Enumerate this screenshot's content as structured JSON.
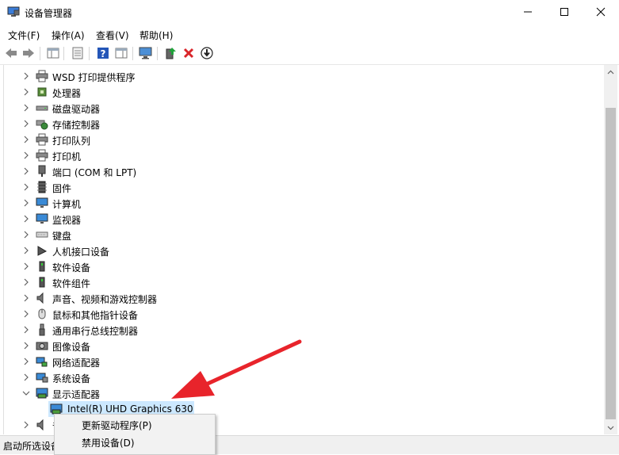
{
  "window": {
    "title": "设备管理器"
  },
  "menu": [
    {
      "label": "文件(F)"
    },
    {
      "label": "操作(A)"
    },
    {
      "label": "查看(V)"
    },
    {
      "label": "帮助(H)"
    }
  ],
  "tree": [
    {
      "label": "WSD 打印提供程序",
      "icon": "printer-provider-icon"
    },
    {
      "label": "处理器",
      "icon": "processor-icon"
    },
    {
      "label": "磁盘驱动器",
      "icon": "disk-drive-icon"
    },
    {
      "label": "存储控制器",
      "icon": "storage-controller-icon"
    },
    {
      "label": "打印队列",
      "icon": "print-queue-icon"
    },
    {
      "label": "打印机",
      "icon": "printer-icon"
    },
    {
      "label": "端口 (COM 和 LPT)",
      "icon": "port-icon"
    },
    {
      "label": "固件",
      "icon": "firmware-icon"
    },
    {
      "label": "计算机",
      "icon": "computer-icon"
    },
    {
      "label": "监视器",
      "icon": "monitor-icon"
    },
    {
      "label": "键盘",
      "icon": "keyboard-icon"
    },
    {
      "label": "人机接口设备",
      "icon": "hid-icon"
    },
    {
      "label": "软件设备",
      "icon": "software-device-icon"
    },
    {
      "label": "软件组件",
      "icon": "software-component-icon"
    },
    {
      "label": "声音、视频和游戏控制器",
      "icon": "sound-icon"
    },
    {
      "label": "鼠标和其他指针设备",
      "icon": "mouse-icon"
    },
    {
      "label": "通用串行总线控制器",
      "icon": "usb-icon"
    },
    {
      "label": "图像设备",
      "icon": "camera-icon"
    },
    {
      "label": "网络适配器",
      "icon": "network-adapter-icon"
    },
    {
      "label": "系统设备",
      "icon": "system-device-icon"
    },
    {
      "label": "显示适配器",
      "icon": "display-adapter-icon",
      "expanded": true
    }
  ],
  "display_child": {
    "label": "Intel(R) UHD Graphics 630"
  },
  "partial_row": {
    "label": "音"
  },
  "context_menu": {
    "items": [
      {
        "label": "更新驱动程序(P)"
      },
      {
        "label": "禁用设备(D)"
      }
    ]
  },
  "status": {
    "text": "启动所选设备"
  },
  "colors": {
    "selection": "#cce8ff",
    "arrow": "#e8242b",
    "help": "#2456b8",
    "delete": "#d9252a"
  }
}
